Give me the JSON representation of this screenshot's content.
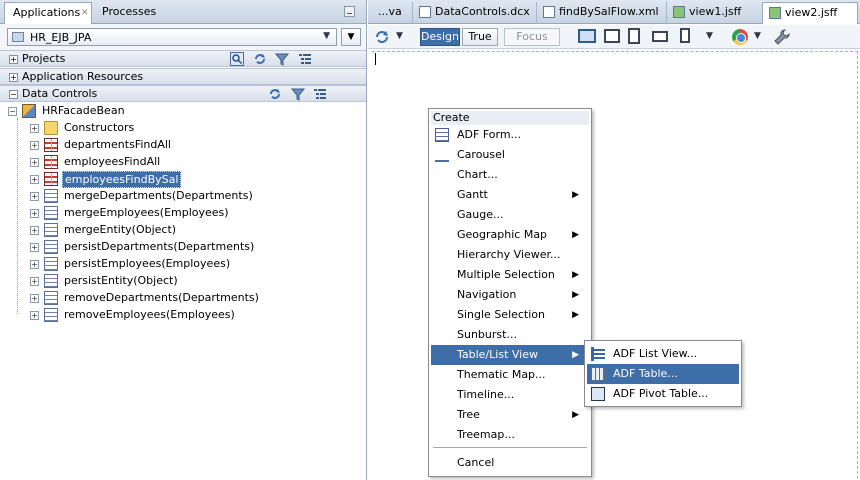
{
  "left_panel": {
    "tabs": [
      {
        "label": "Applications",
        "active": true
      },
      {
        "label": "Processes",
        "active": false
      }
    ],
    "application_selector": {
      "value": "HR_EJB_JPA"
    },
    "accordions": {
      "projects": "Projects",
      "application_resources": "Application Resources",
      "data_controls": "Data Controls"
    },
    "tree": {
      "root": "HRFacadeBean",
      "children": [
        {
          "label": "Constructors",
          "icon": "folder-icon"
        },
        {
          "label": "departmentsFindAll",
          "icon": "collection-icon"
        },
        {
          "label": "employeesFindAll",
          "icon": "collection-icon"
        },
        {
          "label": "employeesFindBySal",
          "icon": "collection-icon",
          "selected": true
        },
        {
          "label": "mergeDepartments(Departments)",
          "icon": "method-icon"
        },
        {
          "label": "mergeEmployees(Employees)",
          "icon": "method-icon"
        },
        {
          "label": "mergeEntity(Object)",
          "icon": "method-icon"
        },
        {
          "label": "persistDepartments(Departments)",
          "icon": "method-icon"
        },
        {
          "label": "persistEmployees(Employees)",
          "icon": "method-icon"
        },
        {
          "label": "persistEntity(Object)",
          "icon": "method-icon"
        },
        {
          "label": "removeDepartments(Departments)",
          "icon": "method-icon"
        },
        {
          "label": "removeEmployees(Employees)",
          "icon": "method-icon"
        }
      ]
    }
  },
  "editor": {
    "tabs": [
      {
        "label": "...va",
        "active": false
      },
      {
        "label": "DataControls.dcx",
        "active": false
      },
      {
        "label": "findBySalFlow.xml",
        "active": false
      },
      {
        "label": "view1.jsff",
        "active": false
      },
      {
        "label": "view2.jsff",
        "active": true
      }
    ],
    "toolbar": {
      "design_label": "Design",
      "true_label": "True",
      "focus_label": "Focus"
    }
  },
  "context_menu": {
    "header": "Create",
    "items": [
      {
        "label": "ADF Form...",
        "submenu": false,
        "icon": "form-icon"
      },
      {
        "label": "Carousel",
        "submenu": false,
        "icon": "carousel-icon"
      },
      {
        "label": "Chart...",
        "submenu": false
      },
      {
        "label": "Gantt",
        "submenu": true
      },
      {
        "label": "Gauge...",
        "submenu": false
      },
      {
        "label": "Geographic Map",
        "submenu": true
      },
      {
        "label": "Hierarchy Viewer...",
        "submenu": false
      },
      {
        "label": "Multiple Selection",
        "submenu": true
      },
      {
        "label": "Navigation",
        "submenu": true
      },
      {
        "label": "Single Selection",
        "submenu": true
      },
      {
        "label": "Sunburst...",
        "submenu": false
      },
      {
        "label": "Table/List View",
        "submenu": true,
        "highlighted": true
      },
      {
        "label": "Thematic Map...",
        "submenu": false
      },
      {
        "label": "Timeline...",
        "submenu": false
      },
      {
        "label": "Tree",
        "submenu": true
      },
      {
        "label": "Treemap...",
        "submenu": false
      },
      {
        "label": "Cancel",
        "submenu": false
      }
    ]
  },
  "submenu": {
    "items": [
      {
        "label": "ADF List View...",
        "icon": "list-view-icon"
      },
      {
        "label": "ADF Table...",
        "icon": "table-icon",
        "highlighted": true
      },
      {
        "label": "ADF Pivot Table...",
        "icon": "pivot-table-icon"
      }
    ]
  },
  "colors": {
    "selection": "#3d6ea8",
    "panel_header": "#c8d4e3",
    "canvas_border": "#e9a35a"
  }
}
